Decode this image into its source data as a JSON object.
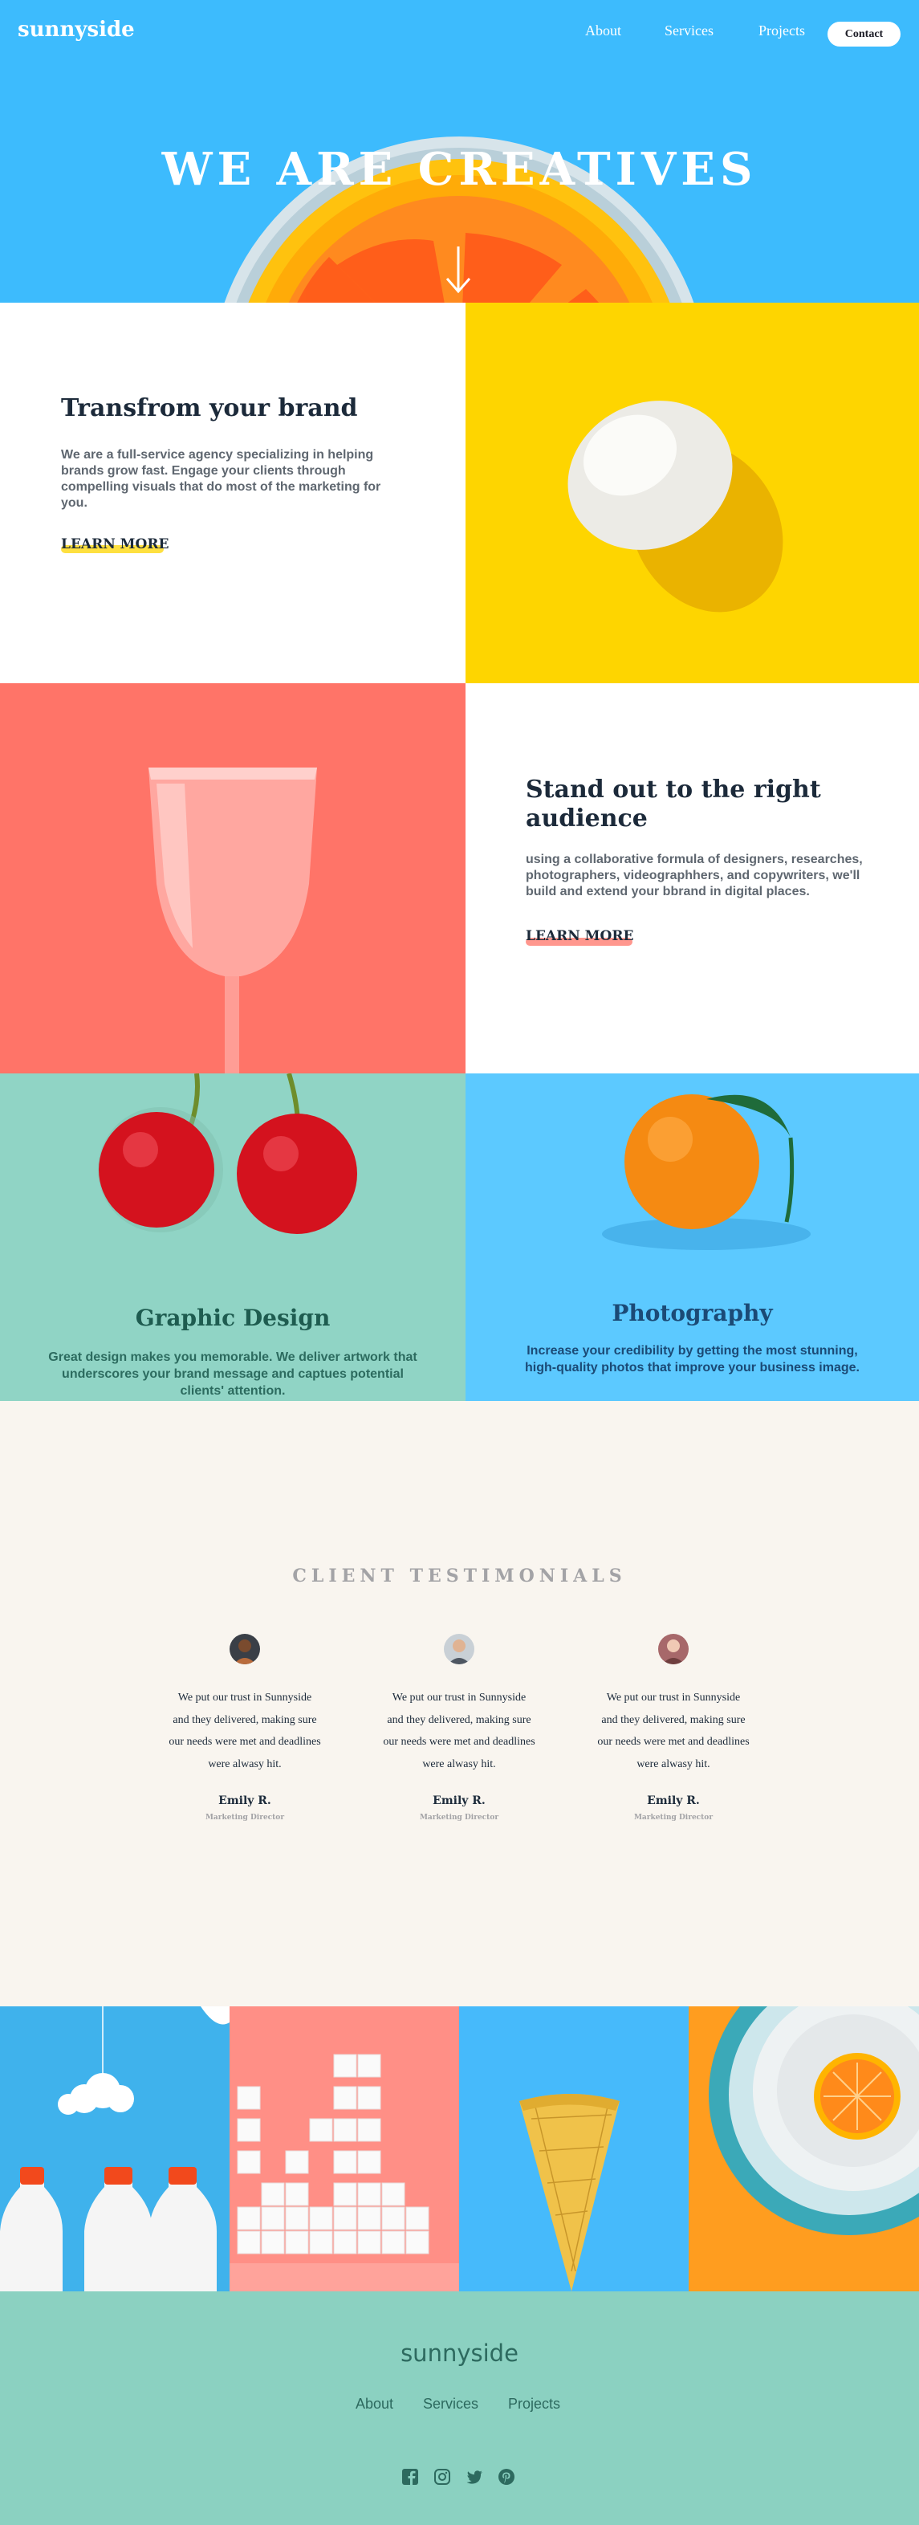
{
  "brand": "sunnyside",
  "nav": {
    "about": "About",
    "services": "Services",
    "projects": "Projects",
    "contact": "Contact"
  },
  "hero": {
    "title": "WE ARE CREATIVES"
  },
  "transform": {
    "title": "Transfrom your brand",
    "text": "We are a full-service agency specializing in helping brands grow fast. Engage your clients through compelling visuals that do most of the marketing for you.",
    "link": "LEARN MORE"
  },
  "standout": {
    "title": "Stand out to the right audience",
    "text": "using a collaborative formula of designers, researches, photographers, videographhers, and copywriters, we'll build and extend your bbrand in digital places.",
    "link": "LEARN MORE"
  },
  "graphic": {
    "title": "Graphic Design",
    "text": "Great design makes you memorable. We deliver artwork that underscores your brand message and captues potential clients' attention."
  },
  "photo": {
    "title": "Photography",
    "text": "Increase your credibility by getting the most stunning, high-quality photos that improve your business image."
  },
  "testimonials": {
    "title": "CLIENT TESTIMONIALS",
    "items": [
      {
        "quote": "We put our trust in Sunnyside and they delivered, making sure our needs were met and deadlines were alwasy hit.",
        "name": "Emily R.",
        "role": "Marketing Director"
      },
      {
        "quote": "We put our trust in Sunnyside and they delivered, making sure our needs were met and deadlines were alwasy hit.",
        "name": "Emily R.",
        "role": "Marketing Director"
      },
      {
        "quote": "We put our trust in Sunnyside and they delivered, making sure our needs were met and deadlines were alwasy hit.",
        "name": "Emily R.",
        "role": "Marketing Director"
      }
    ]
  },
  "footer": {
    "brand": "sunnyside",
    "about": "About",
    "services": "Services",
    "projects": "Projects",
    "icons": [
      "facebook-icon",
      "instagram-icon",
      "twitter-icon",
      "pinterest-icon"
    ]
  },
  "colors": {
    "hero_blue": "#3dbbfd",
    "yellow": "#fed500",
    "salmon": "#ff7468",
    "teal": "#90d4c5",
    "light_blue": "#5cc9ff",
    "cream": "#f9f5ef",
    "dark": "#1c2a3a"
  }
}
